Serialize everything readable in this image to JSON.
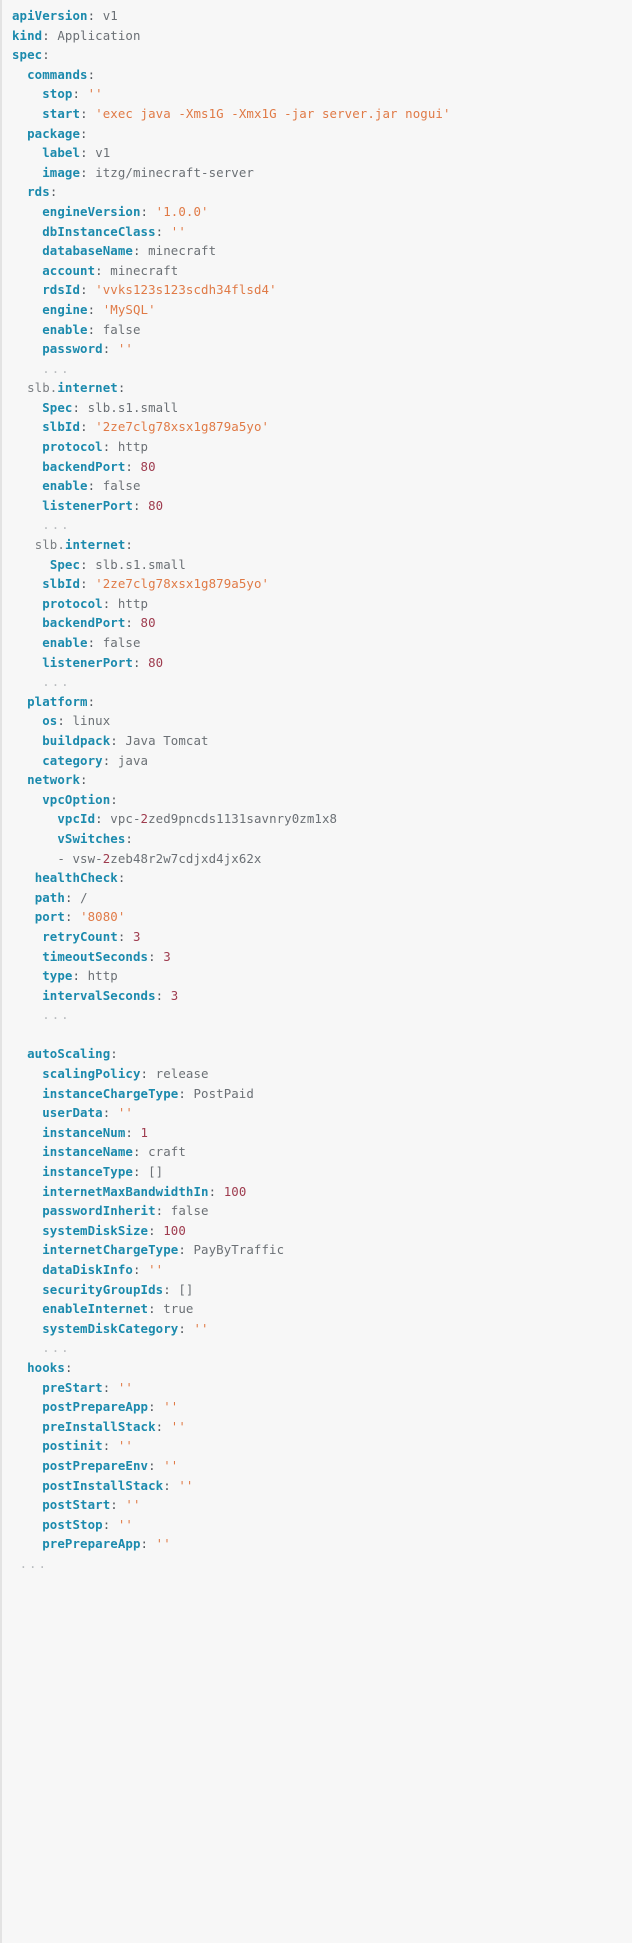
{
  "document": {
    "kind": "yaml-source-listing",
    "language": "yaml",
    "theme": {
      "background": "#f7f7f7",
      "key": "#1b8aad",
      "key_prefix": "#7b7f83",
      "punctuation": "#555a5f",
      "value": "#6b7075",
      "string": "#e07a46",
      "number": "#9e3b4e",
      "ellipsis": "#b9bcbf",
      "gutter_rule": "#e3e3e3"
    }
  },
  "lines": [
    {
      "indent": 0,
      "key": "apiVersion",
      "value": "v1",
      "vtype": "plain"
    },
    {
      "indent": 0,
      "key": "kind",
      "value": "Application",
      "vtype": "plain"
    },
    {
      "indent": 0,
      "key": "spec",
      "value": "",
      "vtype": "map"
    },
    {
      "indent": 1,
      "key": "commands",
      "value": "",
      "vtype": "map"
    },
    {
      "indent": 2,
      "key": "stop",
      "value": "''",
      "vtype": "string"
    },
    {
      "indent": 2,
      "key": "start",
      "value": "'exec java -Xms1G -Xmx1G -jar server.jar nogui'",
      "vtype": "string"
    },
    {
      "indent": 1,
      "key": "package",
      "value": "",
      "vtype": "map"
    },
    {
      "indent": 2,
      "key": "label",
      "value": "v1",
      "vtype": "plain"
    },
    {
      "indent": 2,
      "key": "image",
      "value": "itzg/minecraft-server",
      "vtype": "plain"
    },
    {
      "indent": 1,
      "key": "rds",
      "value": "",
      "vtype": "map"
    },
    {
      "indent": 2,
      "key": "engineVersion",
      "value": "'1.0.0'",
      "vtype": "string"
    },
    {
      "indent": 2,
      "key": "dbInstanceClass",
      "value": "''",
      "vtype": "string"
    },
    {
      "indent": 2,
      "key": "databaseName",
      "value": "minecraft",
      "vtype": "plain"
    },
    {
      "indent": 2,
      "key": "account",
      "value": "minecraft",
      "vtype": "plain"
    },
    {
      "indent": 2,
      "key": "rdsId",
      "value": "'vvks123s123scdh34flsd4'",
      "vtype": "string"
    },
    {
      "indent": 2,
      "key": "engine",
      "value": "'MySQL'",
      "vtype": "string"
    },
    {
      "indent": 2,
      "key": "enable",
      "value": "false",
      "vtype": "plain"
    },
    {
      "indent": 2,
      "key": "password",
      "value": "''",
      "vtype": "string"
    },
    {
      "indent": 2,
      "key": "",
      "value": "...",
      "vtype": "ellipsis"
    },
    {
      "indent": 1,
      "key_prefix": "slb.",
      "key": "internet",
      "value": "",
      "vtype": "map"
    },
    {
      "indent": 2,
      "key": "Spec",
      "value": "slb.s1.small",
      "vtype": "plain"
    },
    {
      "indent": 2,
      "key": "slbId",
      "value": "'2ze7clg78xsx1g879a5yo'",
      "vtype": "string"
    },
    {
      "indent": 2,
      "key": "protocol",
      "value": "http",
      "vtype": "plain"
    },
    {
      "indent": 2,
      "key": "backendPort",
      "value": "80",
      "vtype": "number"
    },
    {
      "indent": 2,
      "key": "enable",
      "value": "false",
      "vtype": "plain"
    },
    {
      "indent": 2,
      "key": "listenerPort",
      "value": "80",
      "vtype": "number"
    },
    {
      "indent": 2,
      "key": "",
      "value": "...",
      "vtype": "ellipsis"
    },
    {
      "indent": 1,
      "extra": 1,
      "key_prefix": "slb.",
      "key": "internet",
      "value": "",
      "vtype": "map"
    },
    {
      "indent": 2,
      "extra": 1,
      "key": "Spec",
      "value": "slb.s1.small",
      "vtype": "plain"
    },
    {
      "indent": 2,
      "key": "slbId",
      "value": "'2ze7clg78xsx1g879a5yo'",
      "vtype": "string"
    },
    {
      "indent": 2,
      "key": "protocol",
      "value": "http",
      "vtype": "plain"
    },
    {
      "indent": 2,
      "key": "backendPort",
      "value": "80",
      "vtype": "number"
    },
    {
      "indent": 2,
      "key": "enable",
      "value": "false",
      "vtype": "plain"
    },
    {
      "indent": 2,
      "key": "listenerPort",
      "value": "80",
      "vtype": "number"
    },
    {
      "indent": 2,
      "key": "",
      "value": "...",
      "vtype": "ellipsis"
    },
    {
      "indent": 1,
      "key": "platform",
      "value": "",
      "vtype": "map"
    },
    {
      "indent": 2,
      "key": "os",
      "value": "linux",
      "vtype": "plain"
    },
    {
      "indent": 2,
      "key": "buildpack",
      "value": "Java Tomcat",
      "vtype": "plain"
    },
    {
      "indent": 2,
      "key": "category",
      "value": "java",
      "vtype": "plain"
    },
    {
      "indent": 1,
      "key": "network",
      "value": "",
      "vtype": "map"
    },
    {
      "indent": 2,
      "key": "vpcOption",
      "value": "",
      "vtype": "map"
    },
    {
      "indent": 3,
      "key": "vpcId",
      "value": "vpc-2zed9pncds1131savnry0zm1x8",
      "vtype": "id"
    },
    {
      "indent": 3,
      "key": "vSwitches",
      "value": "",
      "vtype": "map"
    },
    {
      "indent": 3,
      "key": "",
      "value": "vsw-2zeb48r2w7cdjxd4jx62x",
      "vtype": "seq-id"
    },
    {
      "indent": 1,
      "extra": 1,
      "key": "healthCheck",
      "value": "",
      "vtype": "map"
    },
    {
      "indent": 2,
      "nudge": -1,
      "key": "path",
      "value": "/",
      "vtype": "plain"
    },
    {
      "indent": 2,
      "nudge": -1,
      "key": "port",
      "value": "'8080'",
      "vtype": "string"
    },
    {
      "indent": 2,
      "key": "retryCount",
      "value": "3",
      "vtype": "number"
    },
    {
      "indent": 2,
      "key": "timeoutSeconds",
      "value": "3",
      "vtype": "number"
    },
    {
      "indent": 2,
      "key": "type",
      "value": "http",
      "vtype": "plain"
    },
    {
      "indent": 2,
      "key": "intervalSeconds",
      "value": "3",
      "vtype": "number"
    },
    {
      "indent": 2,
      "key": "",
      "value": "...",
      "vtype": "ellipsis"
    },
    {
      "indent": 0,
      "blank": true
    },
    {
      "indent": 1,
      "key": "autoScaling",
      "value": "",
      "vtype": "map"
    },
    {
      "indent": 2,
      "key": "scalingPolicy",
      "value": "release",
      "vtype": "plain"
    },
    {
      "indent": 2,
      "key": "instanceChargeType",
      "value": "PostPaid",
      "vtype": "plain"
    },
    {
      "indent": 2,
      "key": "userData",
      "value": "''",
      "vtype": "string"
    },
    {
      "indent": 2,
      "key": "instanceNum",
      "value": "1",
      "vtype": "number"
    },
    {
      "indent": 2,
      "key": "instanceName",
      "value": "craft",
      "vtype": "plain"
    },
    {
      "indent": 2,
      "key": "instanceType",
      "value": "[]",
      "vtype": "plain"
    },
    {
      "indent": 2,
      "key": "internetMaxBandwidthIn",
      "value": "100",
      "vtype": "number"
    },
    {
      "indent": 2,
      "key": "passwordInherit",
      "value": "false",
      "vtype": "plain"
    },
    {
      "indent": 2,
      "key": "systemDiskSize",
      "value": "100",
      "vtype": "number"
    },
    {
      "indent": 2,
      "key": "internetChargeType",
      "value": "PayByTraffic",
      "vtype": "plain"
    },
    {
      "indent": 2,
      "key": "dataDiskInfo",
      "value": "''",
      "vtype": "string"
    },
    {
      "indent": 2,
      "key": "securityGroupIds",
      "value": "[]",
      "vtype": "plain"
    },
    {
      "indent": 2,
      "key": "enableInternet",
      "value": "true",
      "vtype": "plain"
    },
    {
      "indent": 2,
      "key": "systemDiskCategory",
      "value": "''",
      "vtype": "string"
    },
    {
      "indent": 2,
      "key": "",
      "value": "...",
      "vtype": "ellipsis"
    },
    {
      "indent": 1,
      "key": "hooks",
      "value": "",
      "vtype": "map"
    },
    {
      "indent": 2,
      "key": "preStart",
      "value": "''",
      "vtype": "string"
    },
    {
      "indent": 2,
      "key": "postPrepareApp",
      "value": "''",
      "vtype": "string"
    },
    {
      "indent": 2,
      "key": "preInstallStack",
      "value": "''",
      "vtype": "string"
    },
    {
      "indent": 2,
      "key": "postinit",
      "value": "''",
      "vtype": "string"
    },
    {
      "indent": 2,
      "key": "postPrepareEnv",
      "value": "''",
      "vtype": "string"
    },
    {
      "indent": 2,
      "key": "postInstallStack",
      "value": "''",
      "vtype": "string"
    },
    {
      "indent": 2,
      "key": "postStart",
      "value": "''",
      "vtype": "string"
    },
    {
      "indent": 2,
      "key": "postStop",
      "value": "''",
      "vtype": "string"
    },
    {
      "indent": 2,
      "key": "prePrepareApp",
      "value": "''",
      "vtype": "string"
    },
    {
      "indent": 1,
      "nudge": -1,
      "key": "",
      "value": "...",
      "vtype": "ellipsis"
    }
  ]
}
